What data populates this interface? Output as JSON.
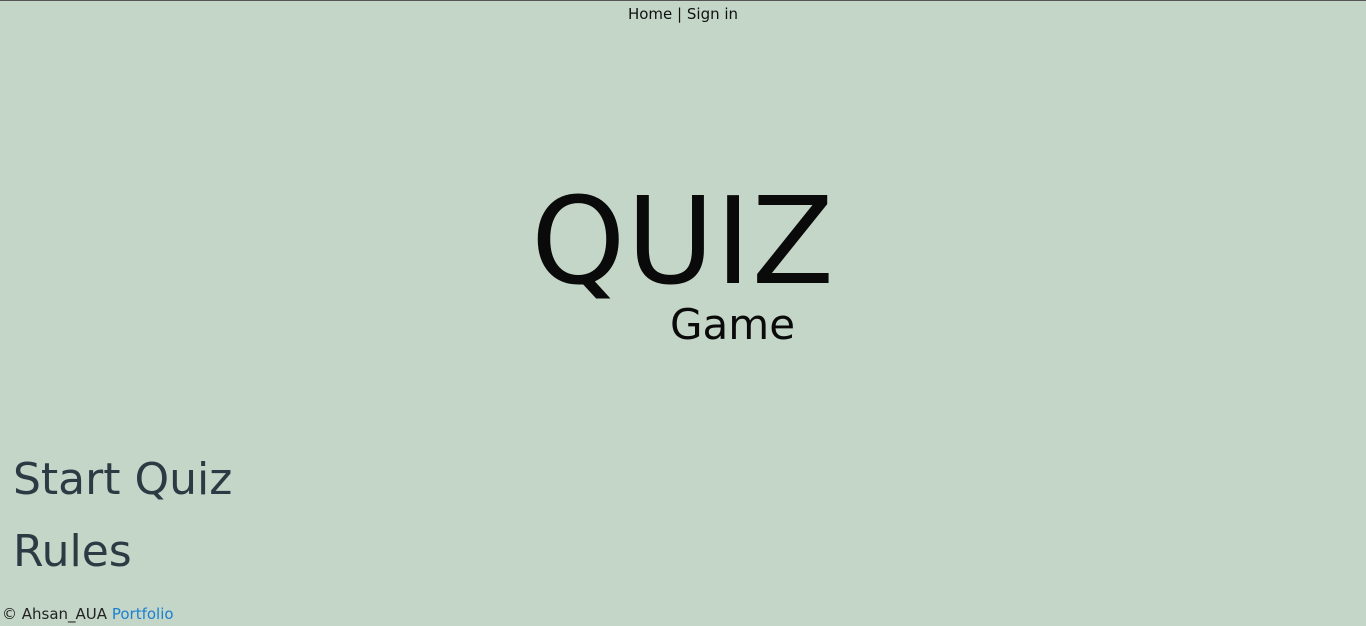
{
  "nav": {
    "home": "Home",
    "separator": "|",
    "sign_in": "Sign in"
  },
  "hero": {
    "title": "QUIZ",
    "subtitle": "Game"
  },
  "menu": {
    "start_quiz": "Start Quiz",
    "rules": "Rules"
  },
  "footer": {
    "copyright": "© Ahsan_AUA",
    "portfolio": "Portfolio"
  },
  "colors": {
    "background": "#c4d6c7",
    "menu_text": "#2c3a44",
    "link": "#1a80d0"
  }
}
